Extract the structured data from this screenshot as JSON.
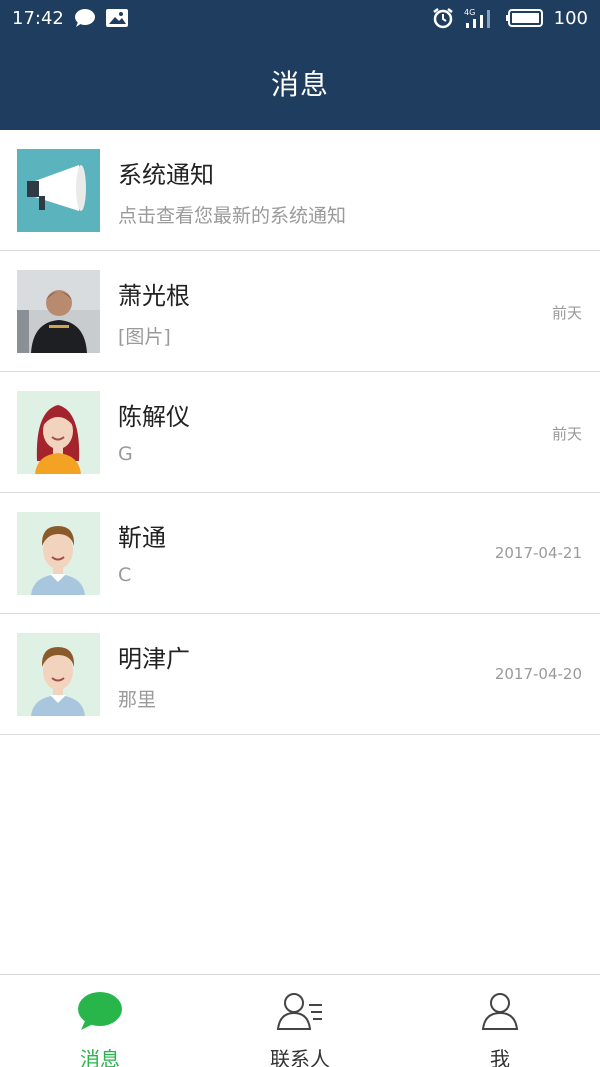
{
  "status_bar": {
    "time": "17:42",
    "signal_label": "4G",
    "battery": "100"
  },
  "header": {
    "title": "消息"
  },
  "conversations": [
    {
      "name": "系统通知",
      "message": "点击查看您最新的系统通知",
      "time": "",
      "avatar": "megaphone"
    },
    {
      "name": "萧光根",
      "message": "[图片]",
      "time": "前天",
      "avatar": "photo"
    },
    {
      "name": "陈解仪",
      "message": "G",
      "time": "前天",
      "avatar": "female"
    },
    {
      "name": "靳通",
      "message": "C",
      "time": "2017-04-21",
      "avatar": "male"
    },
    {
      "name": "明津广",
      "message": "那里",
      "time": "2017-04-20",
      "avatar": "male"
    }
  ],
  "tabs": [
    {
      "label": "消息",
      "icon": "chat-bubble-icon",
      "active": true
    },
    {
      "label": "联系人",
      "icon": "contacts-icon",
      "active": false
    },
    {
      "label": "我",
      "icon": "person-icon",
      "active": false
    }
  ],
  "colors": {
    "header_bg": "#1f3d5e",
    "accent": "#28b64b"
  }
}
